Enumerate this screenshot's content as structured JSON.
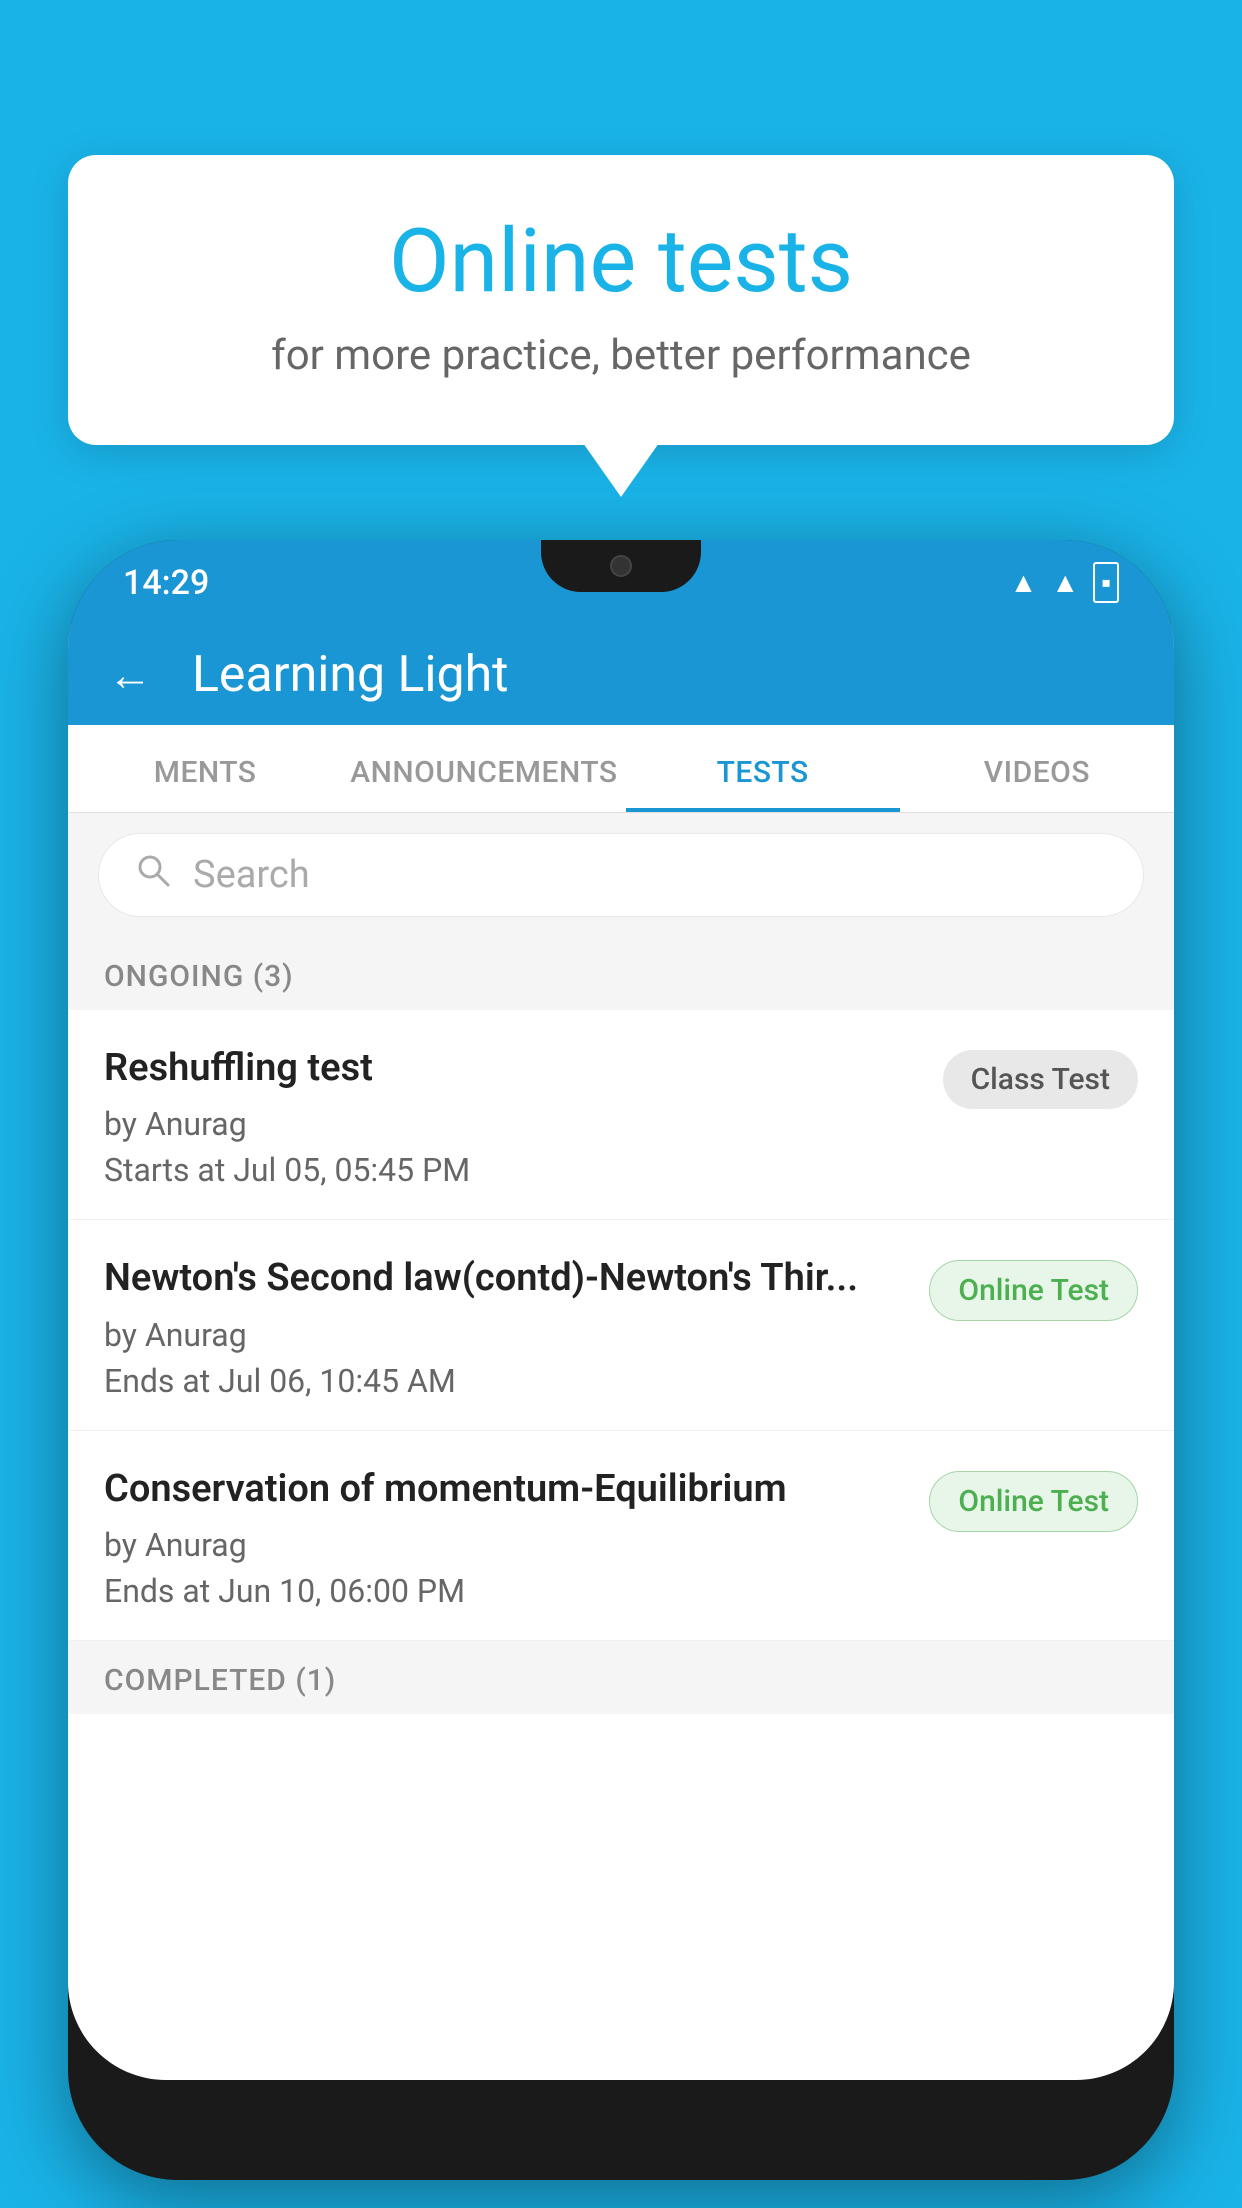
{
  "background_color": "#1ab3e8",
  "speech_bubble": {
    "title": "Online tests",
    "subtitle": "for more practice, better performance"
  },
  "phone": {
    "status_bar": {
      "time": "14:29",
      "icons": [
        "wifi",
        "signal",
        "battery"
      ]
    },
    "header": {
      "back_label": "←",
      "title": "Learning Light"
    },
    "tabs": [
      {
        "label": "MENTS",
        "active": false
      },
      {
        "label": "ANNOUNCEMENTS",
        "active": false
      },
      {
        "label": "TESTS",
        "active": true
      },
      {
        "label": "VIDEOS",
        "active": false
      }
    ],
    "search": {
      "placeholder": "Search"
    },
    "ongoing_section": {
      "label": "ONGOING (3)"
    },
    "test_items": [
      {
        "name": "Reshuffling test",
        "author": "by Anurag",
        "date_label": "Starts at",
        "date": "Jul 05, 05:45 PM",
        "badge": "Class Test",
        "badge_type": "class"
      },
      {
        "name": "Newton's Second law(contd)-Newton's Thir...",
        "author": "by Anurag",
        "date_label": "Ends at",
        "date": "Jul 06, 10:45 AM",
        "badge": "Online Test",
        "badge_type": "online"
      },
      {
        "name": "Conservation of momentum-Equilibrium",
        "author": "by Anurag",
        "date_label": "Ends at",
        "date": "Jun 10, 06:00 PM",
        "badge": "Online Test",
        "badge_type": "online"
      }
    ],
    "completed_section": {
      "label": "COMPLETED (1)"
    }
  }
}
